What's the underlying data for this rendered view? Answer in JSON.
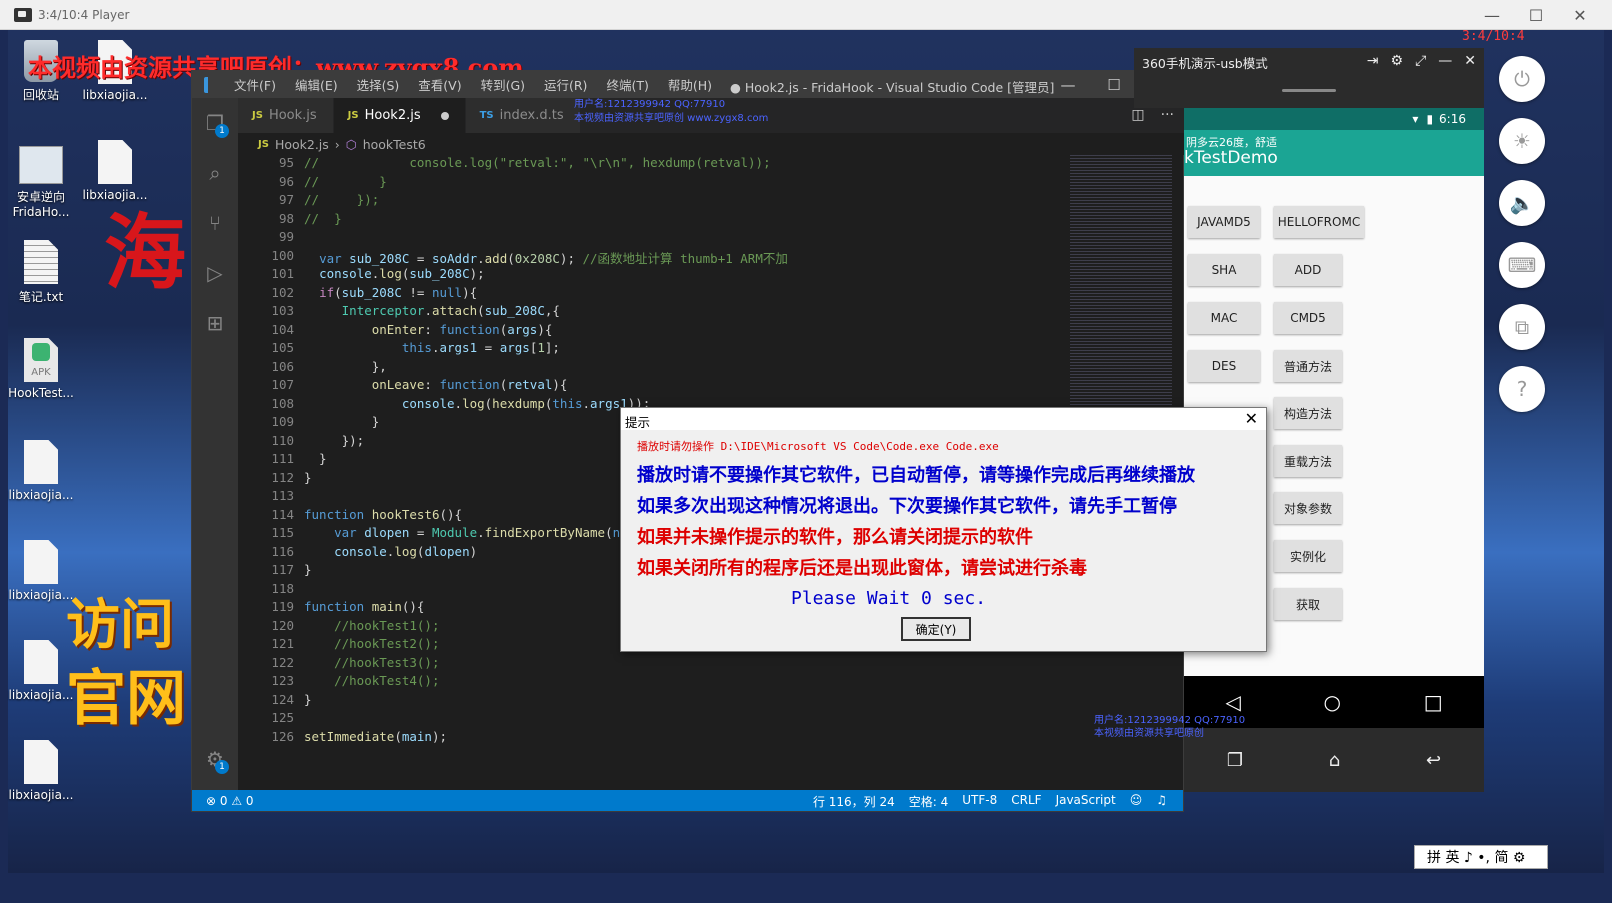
{
  "player": {
    "title": "3:4/10:4 Player",
    "timer": "3:4/10:4"
  },
  "watermark": "本视频由资源共享吧原创：www.zygx8.com",
  "desktop_icons": [
    {
      "name": "recycle-bin",
      "label": "回收站"
    },
    {
      "name": "libx-1",
      "label": "libxiaojia..."
    },
    {
      "name": "android-reverse",
      "label": "安卓逆向\nFridaHo..."
    },
    {
      "name": "libx-2",
      "label": "libxiaojia..."
    },
    {
      "name": "notes",
      "label": "笔记.txt"
    },
    {
      "name": "hooktest-apk",
      "label": "HookTest..."
    },
    {
      "name": "libx-3",
      "label": "libxiaojia..."
    },
    {
      "name": "libx-4",
      "label": "libxiaojia..."
    },
    {
      "name": "libx-5",
      "label": "libxiaojia..."
    },
    {
      "name": "libx-6",
      "label": "libxiaojia..."
    }
  ],
  "promo": {
    "sea": "海",
    "visit": "访问",
    "official": "官网"
  },
  "vscode": {
    "menus": [
      "文件(F)",
      "编辑(E)",
      "选择(S)",
      "查看(V)",
      "转到(G)",
      "运行(R)",
      "终端(T)",
      "帮助(H)"
    ],
    "window_title": "● Hook2.js - FridaHook - Visual Studio Code [管理员]",
    "tabs": [
      {
        "icon": "JS",
        "label": "Hook.js"
      },
      {
        "icon": "JS",
        "label": "Hook2.js"
      },
      {
        "icon": "TS",
        "label": "index.d.ts"
      }
    ],
    "breadcrumb": {
      "file": "Hook2.js",
      "symbol": "hookTest6"
    },
    "line_numbers": [
      "95",
      "96",
      "97",
      "98",
      "99",
      "100",
      "101",
      "102",
      "103",
      "104",
      "105",
      "106",
      "107",
      "108",
      "109",
      "110",
      "111",
      "112",
      "113",
      "114",
      "115",
      "116",
      "117",
      "118",
      "119",
      "120",
      "121",
      "122",
      "123",
      "124",
      "125",
      "126"
    ],
    "status": {
      "problems": "⊗ 0 ⚠ 0",
      "position": "行 116，列 24",
      "spaces": "空格: 4",
      "encoding": "UTF-8",
      "eol": "CRLF",
      "language": "JavaScript"
    },
    "overlay_user": "用户名:1212399942 QQ:77910",
    "overlay_note": "本视频由资源共享吧原创 www.zygx8.com"
  },
  "phone": {
    "window_title": "360手机演示-usb模式",
    "time": "6:16",
    "weather": "阴多云26度，舒适",
    "app_title": "kTestDemo",
    "buttons": [
      "JAVAMD5",
      "HELLOFROMC",
      "SHA",
      "ADD",
      "MAC",
      "CMD5",
      "DES",
      "普通方法",
      "构造方法",
      "重载方法",
      "对象参数",
      "实例化",
      "获取"
    ],
    "overlay": "用户名:1212399942 QQ:77910\n本视频由资源共享吧原创"
  },
  "dialog": {
    "title": "提示",
    "warn": "播放时请勿操作 D:\\IDE\\Microsoft VS Code\\Code.exe  Code.exe",
    "lines": [
      "播放时请不要操作其它软件，已自动暂停，请等操作完成后再继续播放",
      "如果多次出现这种情况将退出。下次要操作其它软件，请先手工暂停",
      "如果并未操作提示的软件，那么请关闭提示的软件",
      "如果关闭所有的程序后还是出现此窗体，请尝试进行杀毒"
    ],
    "wait": "Please Wait  0   sec.",
    "ok": "确定(Y)"
  },
  "ime": "拼 英 ♪ •, 简 ⚙",
  "colors": {
    "vscode_status": "#007acc",
    "phone_bar": "#1ba594",
    "dialog_red": "#dd0000",
    "dialog_blue": "#0000cc"
  }
}
